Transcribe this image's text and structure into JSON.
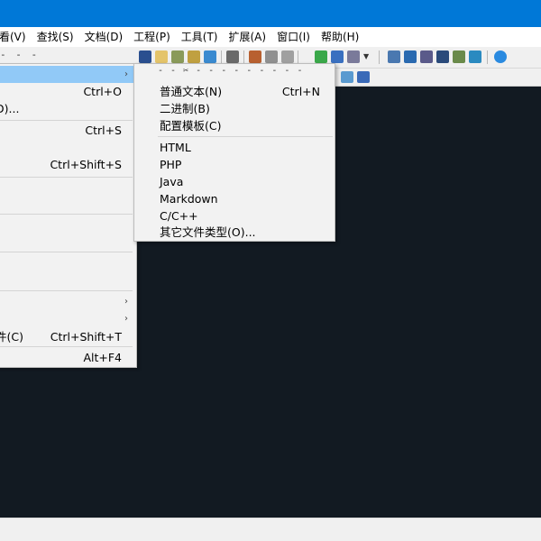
{
  "menubar": {
    "items": [
      {
        "label": "看(V)"
      },
      {
        "label": "查找(S)"
      },
      {
        "label": "文档(D)"
      },
      {
        "label": "工程(P)"
      },
      {
        "label": "工具(T)"
      },
      {
        "label": "扩展(A)"
      },
      {
        "label": "窗口(I)"
      },
      {
        "label": "帮助(H)"
      }
    ]
  },
  "toolbar": {
    "tearoff": "- - -"
  },
  "file_menu": {
    "items": [
      {
        "label": "",
        "shortcut": "",
        "submenu": true
      },
      {
        "label": "",
        "shortcut": "Ctrl+O"
      },
      {
        "label": "D)...",
        "shortcut": ""
      },
      {
        "label": "",
        "shortcut": "Ctrl+S"
      },
      {
        "label": "",
        "shortcut": "Ctrl+Shift+S"
      },
      {
        "label": "件(C)",
        "shortcut": "Ctrl+Shift+T"
      },
      {
        "label": "",
        "shortcut": "Alt+F4"
      }
    ],
    "submenu_arrows": [
      "›",
      "›",
      "›"
    ]
  },
  "new_submenu": {
    "tearoff": "- - ✂ - - - - - - - - -",
    "items": [
      {
        "label": "普通文本(N)",
        "shortcut": "Ctrl+N"
      },
      {
        "label": "二进制(B)",
        "shortcut": ""
      },
      {
        "label": "配置模板(C)",
        "shortcut": ""
      },
      {
        "label": "HTML",
        "shortcut": ""
      },
      {
        "label": "PHP",
        "shortcut": ""
      },
      {
        "label": "Java",
        "shortcut": ""
      },
      {
        "label": "Markdown",
        "shortcut": ""
      },
      {
        "label": "C/C++",
        "shortcut": ""
      },
      {
        "label": "其它文件类型(O)...",
        "shortcut": ""
      }
    ]
  },
  "colors": {
    "titlebar": "#0078d7",
    "editor_background": "#121a22",
    "menu_highlight": "#91c9f7",
    "menu_background": "#f2f2f2"
  }
}
